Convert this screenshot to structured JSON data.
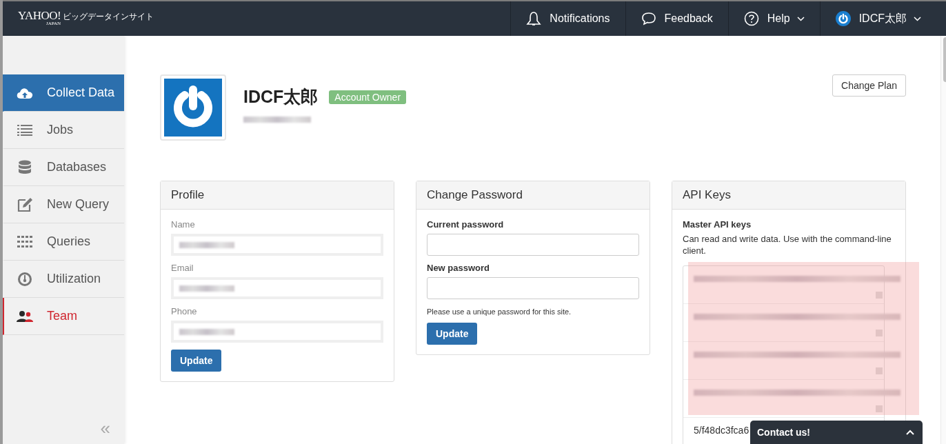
{
  "header": {
    "logo": {
      "brand": "YAHOO!",
      "region": "JAPAN",
      "product": "ビッグデータインサイト"
    },
    "nav": [
      {
        "kind": "bell",
        "label": "Notifications",
        "dropdown": false
      },
      {
        "kind": "chat",
        "label": "Feedback",
        "dropdown": false
      },
      {
        "kind": "help",
        "label": "Help",
        "dropdown": true
      },
      {
        "kind": "power",
        "label": "IDCF太郎",
        "dropdown": true
      }
    ]
  },
  "sidebar": {
    "items": [
      {
        "kind": "cloud",
        "label": "Collect Data",
        "highlighted": true,
        "selected": false
      },
      {
        "kind": "list",
        "label": "Jobs",
        "highlighted": false,
        "selected": false
      },
      {
        "kind": "database",
        "label": "Databases",
        "highlighted": false,
        "selected": false
      },
      {
        "kind": "edit",
        "label": "New Query",
        "highlighted": false,
        "selected": false
      },
      {
        "kind": "grid",
        "label": "Queries",
        "highlighted": false,
        "selected": false
      },
      {
        "kind": "gauge",
        "label": "Utilization",
        "highlighted": false,
        "selected": false
      },
      {
        "kind": "people",
        "label": "Team",
        "highlighted": false,
        "selected": true
      }
    ],
    "collapse": "«"
  },
  "account": {
    "name": "IDCF太郎",
    "badge": "Account Owner",
    "email_redacted": true,
    "change_plan": "Change Plan"
  },
  "profile": {
    "title": "Profile",
    "fields": [
      {
        "label": "Name"
      },
      {
        "label": "Email"
      },
      {
        "label": "Phone"
      }
    ],
    "button": "Update"
  },
  "password": {
    "title": "Change Password",
    "fields": [
      {
        "label": "Current password"
      },
      {
        "label": "New password"
      }
    ],
    "note": "Please use a unique password for this site.",
    "button": "Update"
  },
  "api_keys": {
    "title": "API Keys",
    "heading": "Master API keys",
    "description": "Can read and write data. Use with the command-line client.",
    "keys": [
      {
        "kind": "redacted"
      },
      {
        "kind": "redacted"
      },
      {
        "kind": "redacted"
      },
      {
        "kind": "redacted"
      },
      {
        "kind": "text",
        "value": "5/f48dc3fca6"
      }
    ]
  },
  "contact": {
    "label": "Contact us!"
  }
}
